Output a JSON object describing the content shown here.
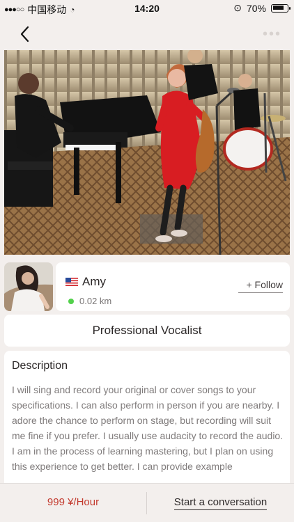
{
  "status": {
    "carrier": "中国移动",
    "time": "14:20",
    "battery": "70%"
  },
  "profile": {
    "name": "Amy",
    "distance": "0.02 km",
    "follow_label": "+ Follow",
    "title": "Professional Vocalist"
  },
  "description": {
    "title": "Description",
    "text": "I will sing and record your original or cover songs to your specifications. I can also perform in person if you are nearby. I adore the chance to perform on stage, but recording will suit me fine if you prefer. I usually use audacity to record the audio. I am in the process of learning mastering, but I plan on using this experience to get better. I can provide example"
  },
  "footer": {
    "price": "999 ¥/Hour",
    "conversation_label": "Start a conversation"
  },
  "icons": {
    "back": "back-icon",
    "more": "more-icon",
    "wifi": "wifi-icon",
    "lock": "lock-icon"
  },
  "colors": {
    "accent": "#c33a2e",
    "online": "#52d14b"
  }
}
